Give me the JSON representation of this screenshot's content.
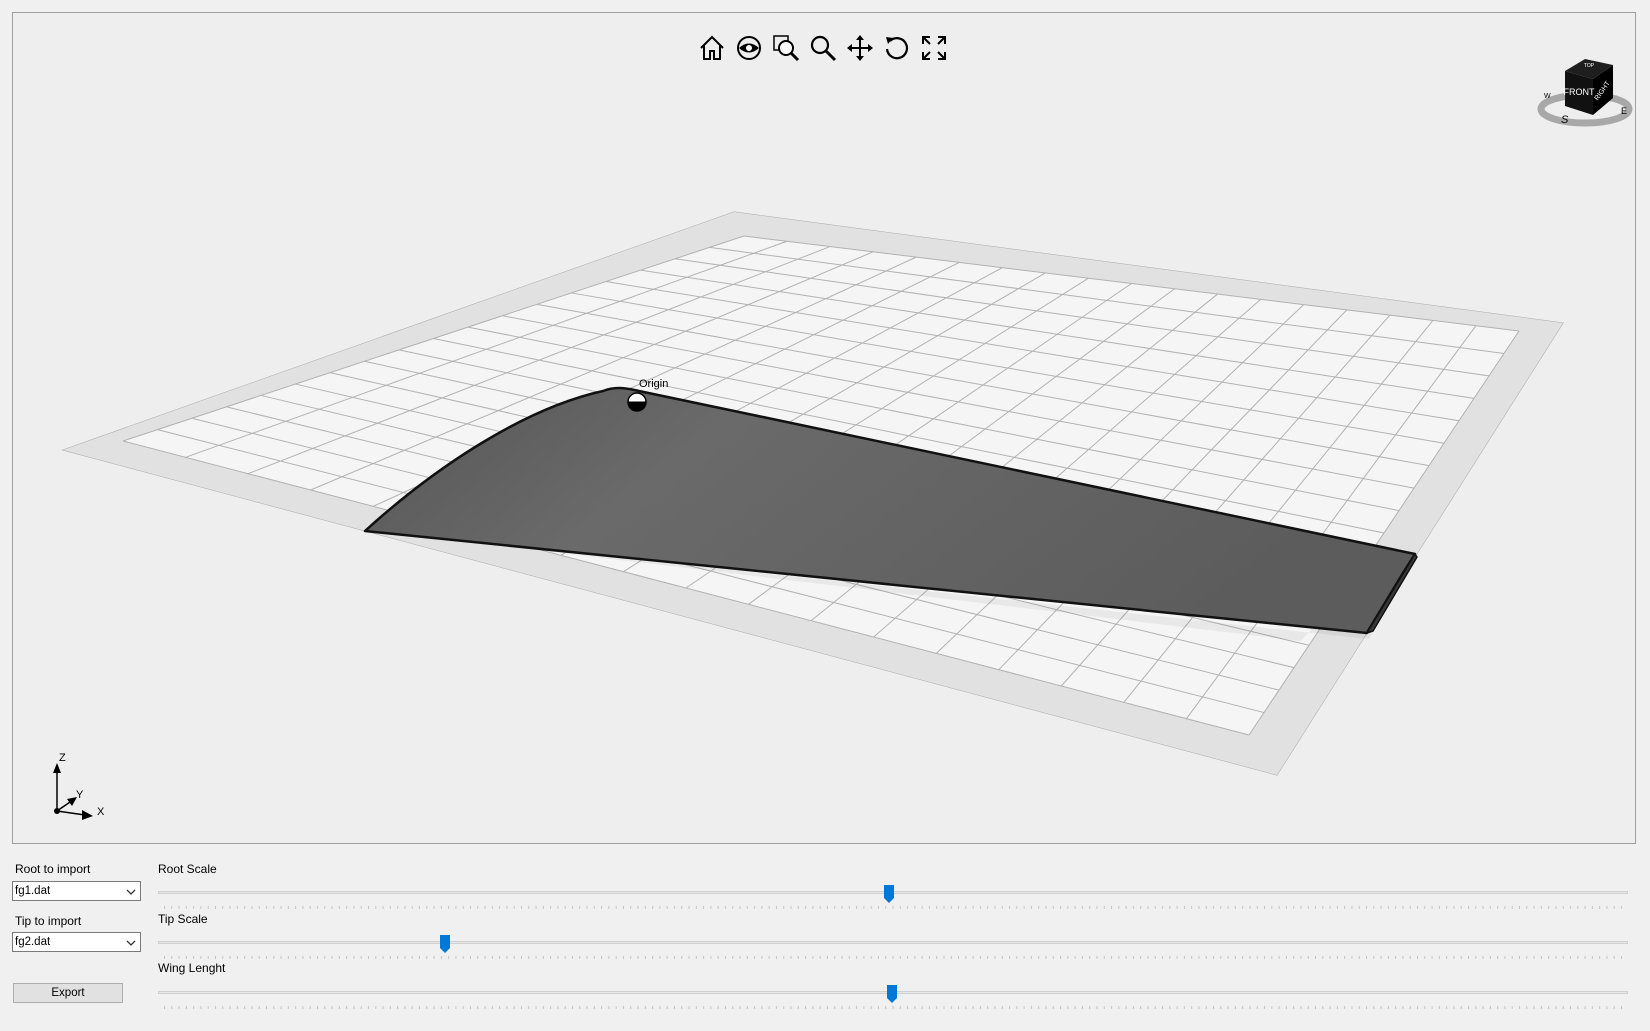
{
  "viewport": {
    "toolbar": [
      {
        "name": "home-icon",
        "title": "Home"
      },
      {
        "name": "orbit-eye-icon",
        "title": "Look"
      },
      {
        "name": "zoom-window-icon",
        "title": "Zoom window"
      },
      {
        "name": "zoom-icon",
        "title": "Zoom"
      },
      {
        "name": "pan-icon",
        "title": "Pan"
      },
      {
        "name": "rotate-icon",
        "title": "Orbit"
      },
      {
        "name": "fit-all-icon",
        "title": "Fit all"
      }
    ],
    "origin_label": "Origin",
    "viewcube": {
      "front": "FRONT",
      "right": "RIGHT",
      "top": "TOP",
      "south": "S",
      "east": "E",
      "west": "W"
    },
    "axis": {
      "x": "X",
      "y": "Y",
      "z": "Z"
    }
  },
  "controls": {
    "root_label": "Root to import",
    "root_value": "fg1.dat",
    "tip_label": "Tip to import",
    "tip_value": "fg2.dat",
    "export_label": "Export"
  },
  "sliders": [
    {
      "key": "root-scale",
      "label": "Root Scale",
      "value": 0.497
    },
    {
      "key": "tip-scale",
      "label": "Tip Scale",
      "value": 0.195
    },
    {
      "key": "wing-length",
      "label": "Wing Lenght",
      "value": 0.499
    }
  ],
  "colors": {
    "accent": "#0078d7",
    "wing_fill": "#5f5f5f",
    "grid_plane": "#f5f5f5",
    "viewport_bg": "#eeeeee"
  }
}
